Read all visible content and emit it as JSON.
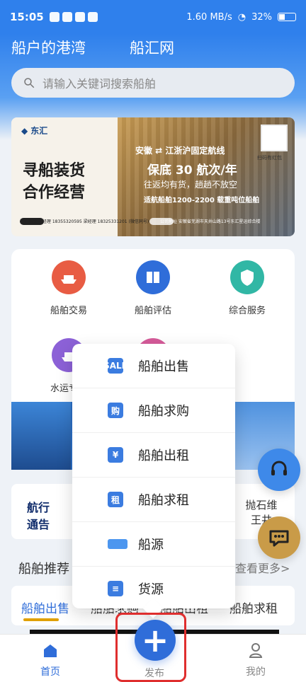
{
  "status_bar": {
    "time": "15:05",
    "network_speed": "1.60\nMB/s",
    "battery": "32%"
  },
  "top_tabs": [
    "船户的港湾",
    "船汇网"
  ],
  "search": {
    "placeholder": "请输入关键词搜索船舶"
  },
  "banner": {
    "logo_text": "东汇",
    "calligraphy_line_1": "寻船装货",
    "calligraphy_line_2": "合作经营",
    "route_title": "安徽 ⇄ 江浙沪固定航线",
    "guarantee": "保底 30 航次/年",
    "slogan": "往返均有货，趟趟不放空",
    "detail": "适航船舶1200-2200 载重吨位船舶",
    "hotline_label": "扫码有红包",
    "contact": "咨询热线  张经理 18355320595  梁经理 18325331201 (微信同号)",
    "address": "公司地址  安徽省芜湖市天井山路13号东汇星运综合楼"
  },
  "services": [
    {
      "label": "船舶交易",
      "icon": "ship-icon"
    },
    {
      "label": "船舶评估",
      "icon": "book-icon"
    },
    {
      "label": "综合服务",
      "icon": "shield-icon"
    },
    {
      "label": "水运专线",
      "icon": "ship-icon"
    },
    {
      "label": "",
      "icon": "user-icon"
    }
  ],
  "notice": {
    "mark_top": "航行",
    "mark_bottom": "通告",
    "right_top": "抛石维",
    "right_bottom": "王井"
  },
  "recommend": {
    "title": "船舶推荐",
    "more": "查看更多>",
    "tabs": [
      "船舶出售",
      "船舶求购",
      "船舶出租",
      "船舶求租"
    ]
  },
  "popup_menu": [
    {
      "label": "船舶出售",
      "icon": "sale-icon",
      "icon_text": "SALE"
    },
    {
      "label": "船舶求购",
      "icon": "purchase-icon",
      "icon_text": "购"
    },
    {
      "label": "船舶出租",
      "icon": "rent-out-icon",
      "icon_text": "¥"
    },
    {
      "label": "船舶求租",
      "icon": "rent-seek-icon",
      "icon_text": "租"
    },
    {
      "label": "船源",
      "icon": "ship-source-icon",
      "icon_text": ""
    },
    {
      "label": "货源",
      "icon": "cargo-source-icon",
      "icon_text": "≡"
    }
  ],
  "bottom_nav": {
    "home": "首页",
    "publish": "发布",
    "mine": "我的"
  },
  "colors": {
    "primary": "#2f6dd9",
    "header_blue": "#2f80ec",
    "highlight_red": "#df2e2e",
    "chat_gold": "#c99b48"
  }
}
